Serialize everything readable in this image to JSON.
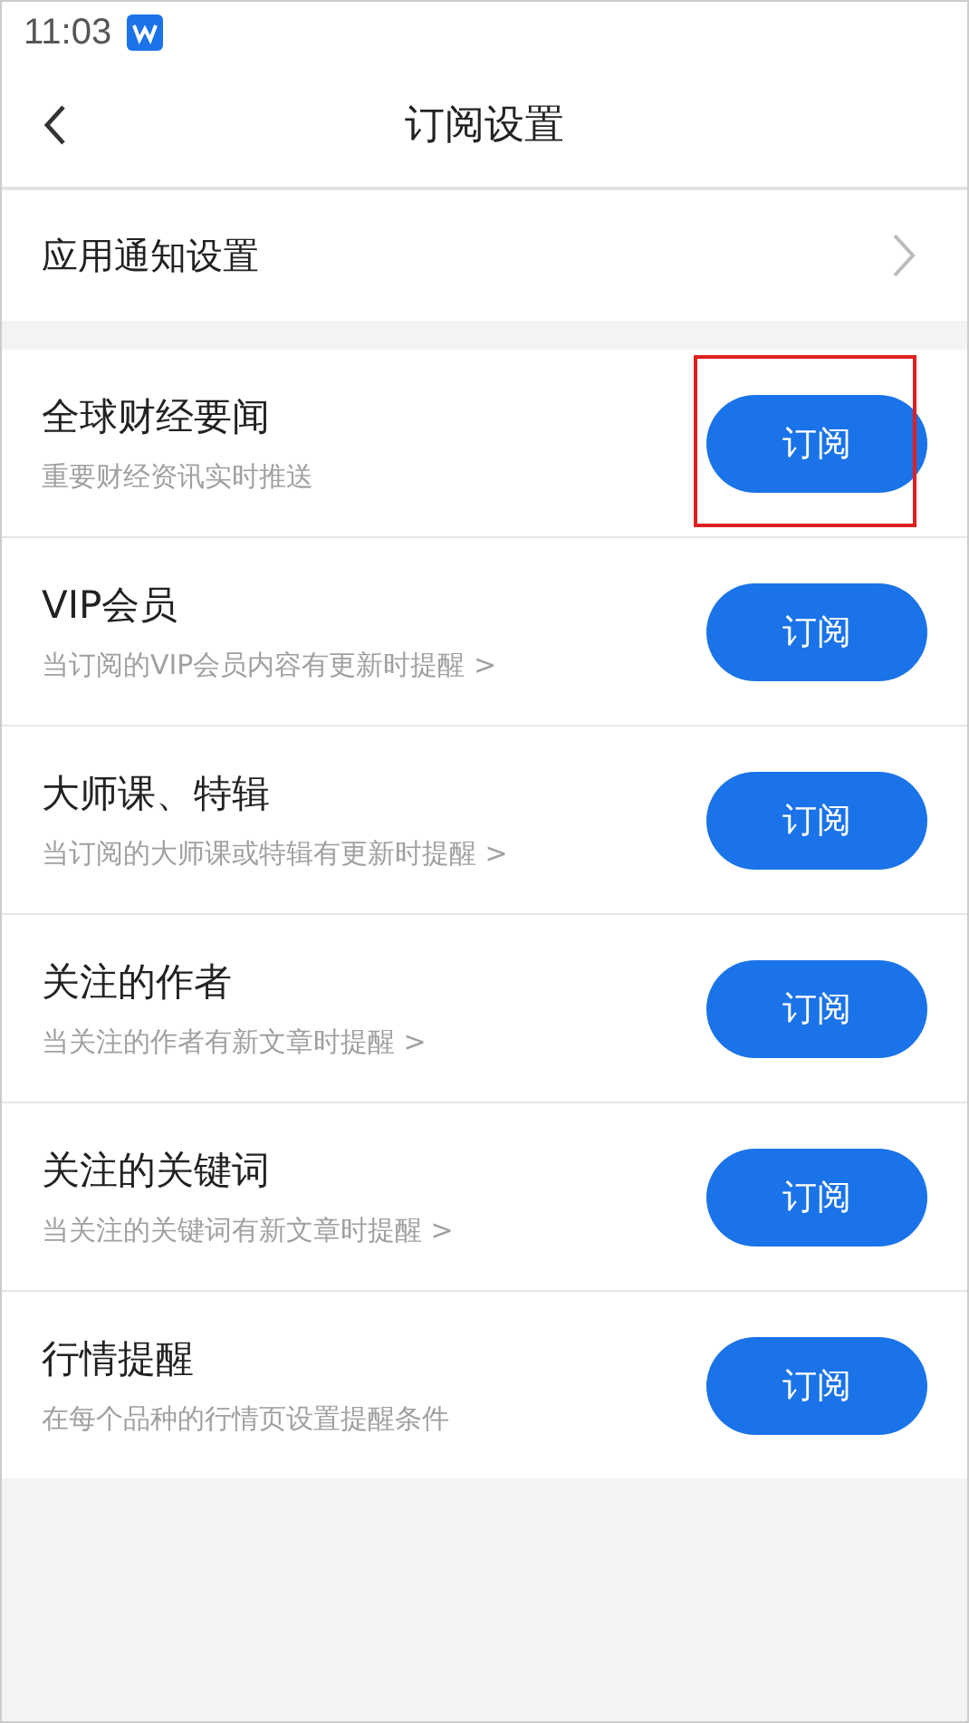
{
  "status_bar": {
    "time": "11:03"
  },
  "header": {
    "title": "订阅设置"
  },
  "notification_row": {
    "label": "应用通知设置"
  },
  "subscriptions": [
    {
      "title": "全球财经要闻",
      "subtitle": "重要财经资讯实时推送",
      "button": "订阅",
      "highlighted": true
    },
    {
      "title": "VIP会员",
      "subtitle": "当订阅的VIP会员内容有更新时提醒 >",
      "button": "订阅",
      "highlighted": false
    },
    {
      "title": "大师课、特辑",
      "subtitle": "当订阅的大师课或特辑有更新时提醒 >",
      "button": "订阅",
      "highlighted": false
    },
    {
      "title": "关注的作者",
      "subtitle": "当关注的作者有新文章时提醒 >",
      "button": "订阅",
      "highlighted": false
    },
    {
      "title": "关注的关键词",
      "subtitle": "当关注的关键词有新文章时提醒 >",
      "button": "订阅",
      "highlighted": false
    },
    {
      "title": "行情提醒",
      "subtitle": "在每个品种的行情页设置提醒条件",
      "button": "订阅",
      "highlighted": false
    }
  ]
}
